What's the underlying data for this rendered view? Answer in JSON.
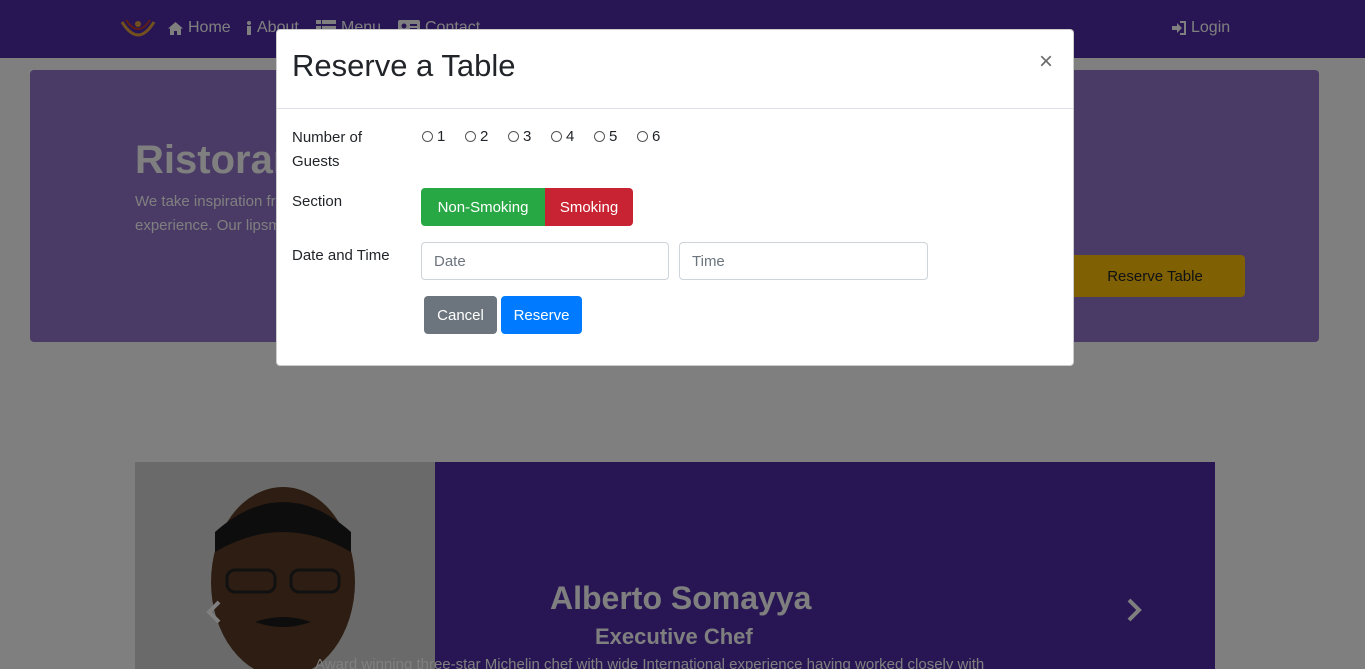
{
  "navbar": {
    "home_label": "Home",
    "about_label": "About",
    "menu_label": "Menu",
    "contact_label": "Contact",
    "login_label": "Login"
  },
  "jumbotron": {
    "title": "Ristorante Con Fusion",
    "description": "We take inspiration from the World's best cuisines, and create a unique fusion experience. Our lipsmacking creations will tickle your culinary senses!",
    "reserve_button": "Reserve Table"
  },
  "carousel": {
    "chef_name": "Alberto Somayya",
    "chef_title": "Executive Chef",
    "chef_description": "Award winning three-star Michelin chef with wide International experience having worked closely with"
  },
  "modal": {
    "title": "Reserve a Table",
    "close_symbol": "×",
    "guests_label": "Number of Guests",
    "guest_options": [
      "1",
      "2",
      "3",
      "4",
      "5",
      "6"
    ],
    "section_label": "Section",
    "non_smoking_label": "Non-Smoking",
    "smoking_label": "Smoking",
    "datetime_label": "Date and Time",
    "date_placeholder": "Date",
    "time_placeholder": "Time",
    "cancel_label": "Cancel",
    "reserve_label": "Reserve"
  },
  "colors": {
    "primary": "#512DA8",
    "jumbotron": "#9575CD",
    "success": "#28A745",
    "danger": "#C82333",
    "secondary": "#6C757D",
    "blue": "#007BFF",
    "warning": "#FFC107"
  }
}
